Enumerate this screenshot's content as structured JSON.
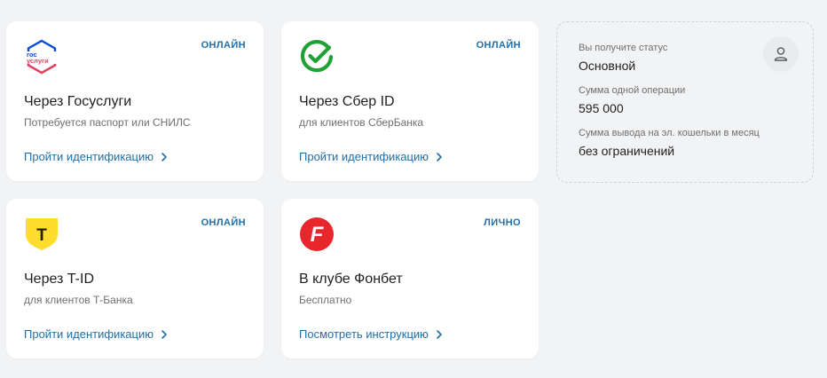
{
  "cards": [
    {
      "badge": "ОНЛАЙН",
      "title": "Через Госуслуги",
      "subtitle": "Потребуется паспорт или СНИЛС",
      "link": "Пройти идентификацию",
      "logo_text_1": "гос",
      "logo_text_2": "услуги",
      "icon": "gosuslugi-logo"
    },
    {
      "badge": "ОНЛАЙН",
      "title": "Через Сбер ID",
      "subtitle": "для клиентов СберБанка",
      "link": "Пройти идентификацию",
      "icon": "sber-logo"
    },
    {
      "badge": "ОНЛАЙН",
      "title": "Через T-ID",
      "subtitle": "для клиентов Т-Банка",
      "link": "Пройти идентификацию",
      "logo_text": "T",
      "icon": "tbank-logo"
    },
    {
      "badge": "ЛИЧНО",
      "title": "В клубе Фонбет",
      "subtitle": "Бесплатно",
      "link": "Посмотреть инструкцию",
      "logo_text": "F",
      "icon": "fonbet-logo"
    }
  ],
  "status": {
    "status_label": "Вы получите статус",
    "status_value": "Основной",
    "operation_label": "Сумма одной операции",
    "operation_value": "595 000",
    "withdraw_label": "Сумма вывода на эл. кошельки в месяц",
    "withdraw_value": "без ограничений",
    "icon": "user-icon"
  },
  "colors": {
    "accent": "#1f6fa8",
    "sber": "#21a038",
    "tbank": "#ffdd2d",
    "fonbet": "#e8262c",
    "gos_blue": "#0d4cd3",
    "gos_red": "#ee3f58"
  }
}
